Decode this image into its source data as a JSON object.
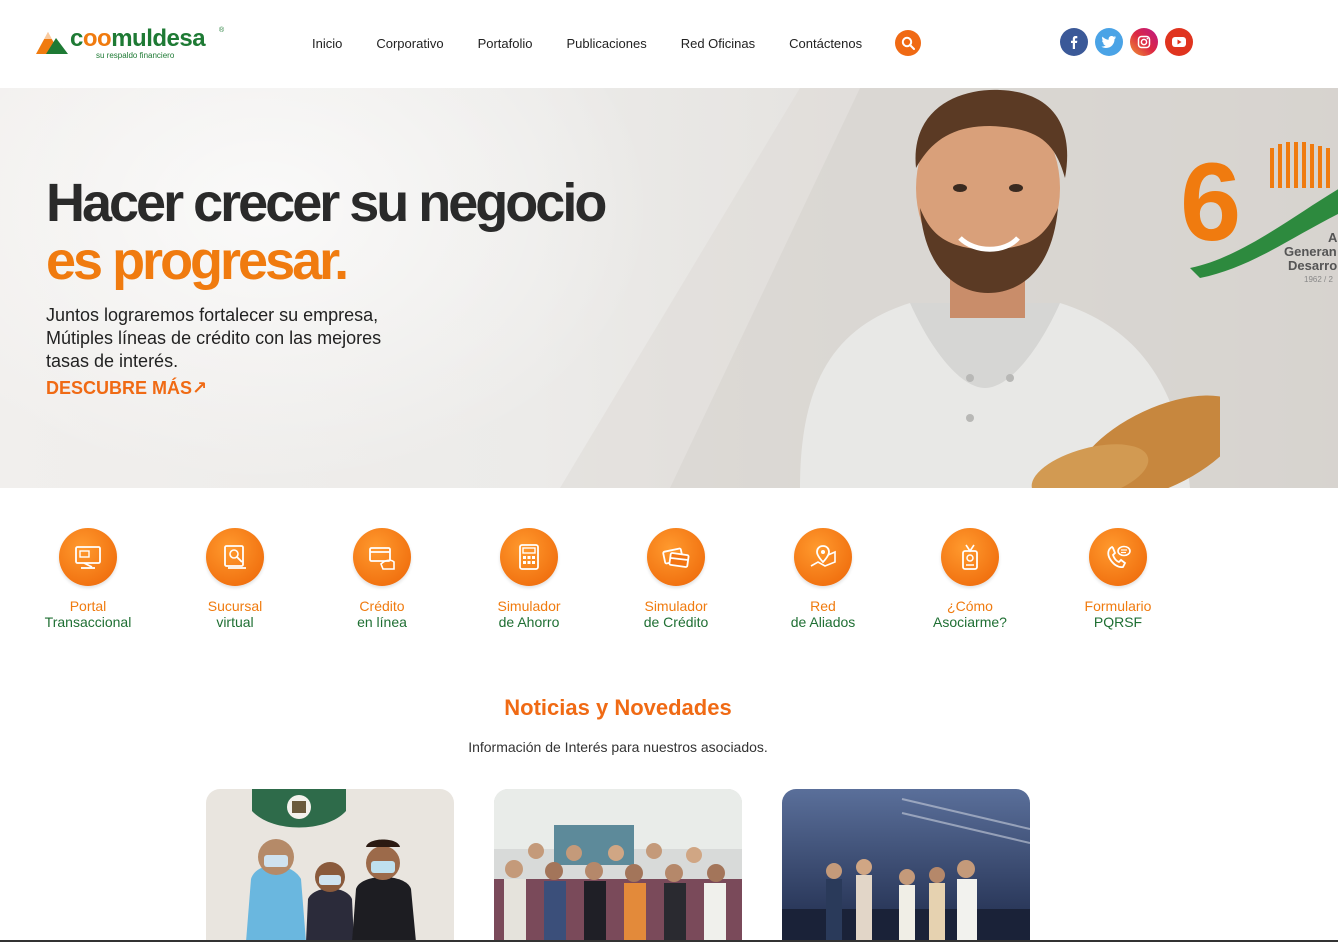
{
  "header": {
    "logo_text_a": "c",
    "logo_text_oo": "oo",
    "logo_text_b": "muldesa",
    "logo_reg": "®",
    "logo_tagline": "su respaldo financiero",
    "nav": [
      "Inicio",
      "Corporativo",
      "Portafolio",
      "Publicaciones",
      "Red Oficinas",
      "Contáctenos"
    ],
    "search_icon": "search-icon",
    "social": [
      {
        "name": "facebook-icon",
        "glyph": "f",
        "color": "#3b5998"
      },
      {
        "name": "twitter-icon",
        "glyph": "t",
        "color": "#4aa3e6"
      },
      {
        "name": "instagram-icon",
        "glyph": "◎",
        "color": "#dc2743"
      },
      {
        "name": "youtube-icon",
        "glyph": "▶",
        "color": "#e0341f"
      }
    ]
  },
  "hero": {
    "title_line1": "Hacer crecer su negocio",
    "title_line2": "es progresar.",
    "text": "Juntos lograremos fortalecer su empresa, Mútiples líneas de crédito con las mejores tasas de interés.",
    "cta": "DESCUBRE MÁS",
    "cta_arrow": "↗",
    "badge_number": "6",
    "badge_line1": "A",
    "badge_line2": "Generan",
    "badge_line3": "Desarro",
    "badge_line4": "1962 / 2"
  },
  "quick_links": [
    {
      "line1": "Portal",
      "line2": "Transaccional",
      "icon": "computer-icon"
    },
    {
      "line1": "Sucursal",
      "line2": "virtual",
      "icon": "online-branch-icon"
    },
    {
      "line1": "Crédito",
      "line2": "en línea",
      "icon": "card-hand-icon"
    },
    {
      "line1": "Simulador",
      "line2": "de Ahorro",
      "icon": "calculator-icon"
    },
    {
      "line1": "Simulador",
      "line2": "de Crédito",
      "icon": "credit-cards-icon"
    },
    {
      "line1": "Red",
      "line2": "de Aliados",
      "icon": "map-pin-icon"
    },
    {
      "line1": "¿Cómo",
      "line2": "Asociarme?",
      "icon": "id-badge-icon"
    },
    {
      "line1": "Formulario",
      "line2": "PQRSF",
      "icon": "phone-chat-icon"
    }
  ],
  "news": {
    "title": "Noticias y Novedades",
    "subtitle": "Información de Interés para nuestros asociados."
  },
  "colors": {
    "brand_orange": "#f06a14",
    "brand_green": "#1e7a34"
  }
}
